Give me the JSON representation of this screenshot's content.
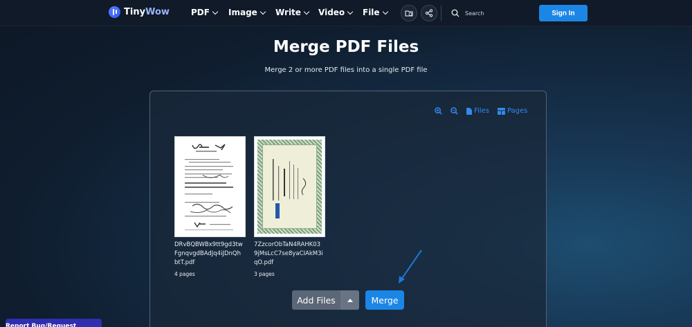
{
  "header": {
    "logo_text_a": "Tiny",
    "logo_text_b": "Wow",
    "nav": [
      {
        "label": "PDF"
      },
      {
        "label": "Image"
      },
      {
        "label": "Write"
      },
      {
        "label": "Video"
      },
      {
        "label": "File"
      }
    ],
    "search_placeholder": "Search",
    "signin_label": "Sign In"
  },
  "page": {
    "title": "Merge PDF Files",
    "subtitle": "Merge 2 or more PDF files into a single PDF file"
  },
  "toolbar": {
    "files_label": "Files",
    "pages_label": "Pages"
  },
  "files": [
    {
      "name": "DRvBQBWBx9tt9gd3twFgnqvgdBAdJq4iJDnQhbtT.pdf",
      "pages": "4 pages"
    },
    {
      "name": "7ZzcorObTaN4RAHK039jMsLcC7se8yaCIAkM3iqO.pdf",
      "pages": "3 pages"
    }
  ],
  "actions": {
    "add_files_label": "Add Files",
    "merge_label": "Merge"
  },
  "report_label": "Report Bug/Request Feature",
  "colors": {
    "accent": "#1c86e6",
    "link": "#2f8bf0",
    "report": "#2f2fb0"
  }
}
